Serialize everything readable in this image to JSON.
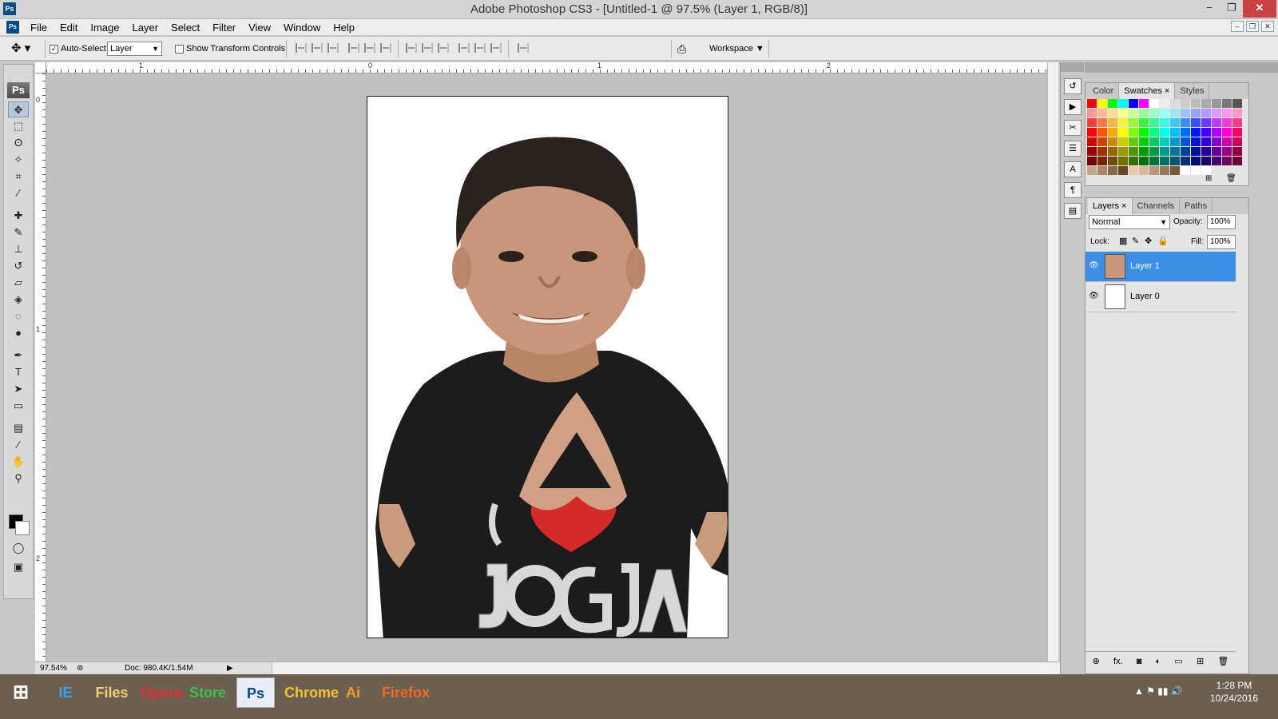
{
  "window": {
    "title": "Adobe Photoshop CS3 - [Untitled-1 @ 97.5% (Layer 1, RGB/8)]",
    "app_badge": "Ps",
    "controls": [
      "−",
      "❐",
      "✕"
    ]
  },
  "menubar": {
    "app_icon": "Ps",
    "items": [
      "File",
      "Edit",
      "Image",
      "Layer",
      "Select",
      "Filter",
      "View",
      "Window",
      "Help"
    ],
    "doc_controls": [
      "–",
      "❐",
      "✕"
    ]
  },
  "options_bar": {
    "auto_select_label": "Auto-Select:",
    "auto_select_checked": true,
    "auto_select_value": "Layer",
    "show_transform_label": "Show Transform Controls",
    "show_transform_checked": false,
    "workspace_label": "Workspace ▼"
  },
  "toolbox": {
    "logo": "Ps",
    "tools": [
      {
        "name": "move-tool",
        "glyph": "✥",
        "active": true
      },
      {
        "name": "marquee-tool",
        "glyph": "⬚"
      },
      {
        "name": "lasso-tool",
        "glyph": "ʘ"
      },
      {
        "name": "magic-wand-tool",
        "glyph": "✧"
      },
      {
        "name": "crop-tool",
        "glyph": "⌗"
      },
      {
        "name": "eyedropper-tool",
        "glyph": "⁄"
      },
      {
        "name": "healing-brush-tool",
        "glyph": "✚"
      },
      {
        "name": "brush-tool",
        "glyph": "✎"
      },
      {
        "name": "clone-stamp-tool",
        "glyph": "⊥"
      },
      {
        "name": "history-brush-tool",
        "glyph": "↺"
      },
      {
        "name": "eraser-tool",
        "glyph": "▱"
      },
      {
        "name": "paint-bucket-tool",
        "glyph": "◈"
      },
      {
        "name": "blur-tool",
        "glyph": "◌"
      },
      {
        "name": "dodge-tool",
        "glyph": "●"
      },
      {
        "name": "pen-tool",
        "glyph": "✒"
      },
      {
        "name": "type-tool",
        "glyph": "T"
      },
      {
        "name": "path-selection-tool",
        "glyph": "➤"
      },
      {
        "name": "shape-tool",
        "glyph": "▭"
      },
      {
        "name": "notes-tool",
        "glyph": "▤"
      },
      {
        "name": "eyedropper2-tool",
        "glyph": "⁄"
      },
      {
        "name": "hand-tool",
        "glyph": "✋"
      },
      {
        "name": "zoom-tool",
        "glyph": "⚲"
      }
    ]
  },
  "rulers": {
    "h_labels": [
      "1",
      "0",
      "1",
      "2"
    ],
    "v_labels": [
      "0",
      "1",
      "2"
    ]
  },
  "status": {
    "zoom": "97.54%",
    "doc_size": "Doc: 980.4K/1.54M"
  },
  "swatches_panel": {
    "tabs": [
      "Color",
      "Swatches ×",
      "Styles"
    ],
    "active_tab": "Swatches ×"
  },
  "layers_panel": {
    "tabs": [
      "Layers ×",
      "Channels",
      "Paths"
    ],
    "blend_mode": "Normal",
    "opacity_label": "Opacity:",
    "opacity_value": "100%",
    "lock_label": "Lock:",
    "fill_label": "Fill:",
    "fill_value": "100%",
    "layers": [
      {
        "name": "Layer 1",
        "selected": true
      },
      {
        "name": "Layer 0",
        "selected": false
      }
    ],
    "footer_icons": [
      "⊕",
      "fx.",
      "◙",
      "◐",
      "▭",
      "⊞",
      "🗑"
    ]
  },
  "taskbar": {
    "time": "1:28 PM",
    "date": "10/24/2016",
    "apps": [
      "IE",
      "Files",
      "Opera",
      "Store",
      "Ps",
      "Chrome",
      "Ai",
      "Firefox"
    ]
  },
  "colors": {
    "accent": "#3d8fe6",
    "shirt": "#1a1a1a",
    "heart": "#d42a2a"
  }
}
